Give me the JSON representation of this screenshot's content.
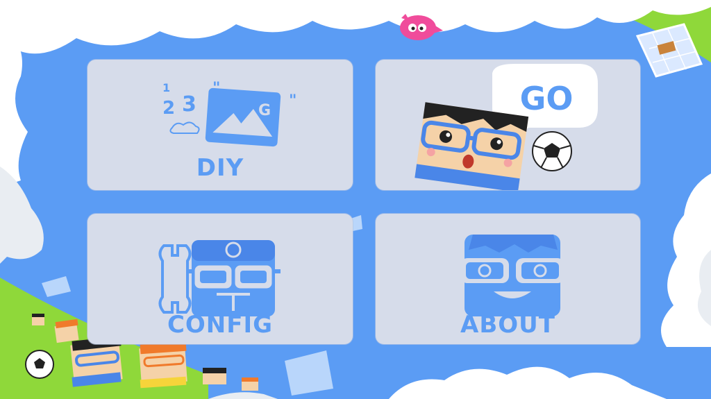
{
  "app": {
    "screen": "main-menu"
  },
  "menu": {
    "diy": {
      "label": "DIY",
      "icon": "diy-comic-icon"
    },
    "go": {
      "label": "GO",
      "icon": "player-with-ball-icon"
    },
    "config": {
      "label": "CONFIG",
      "icon": "wrench-and-player-icon"
    },
    "about": {
      "label": "ABOUT",
      "icon": "player-face-icon"
    }
  },
  "decor": {
    "diy_numbers": [
      "1",
      "2",
      "3"
    ]
  },
  "colors": {
    "sky": "#5b9cf4",
    "tile": "#d6dcea",
    "accent": "#5b9cf4",
    "grass": "#8fd83a",
    "cloud": "#ffffff"
  }
}
